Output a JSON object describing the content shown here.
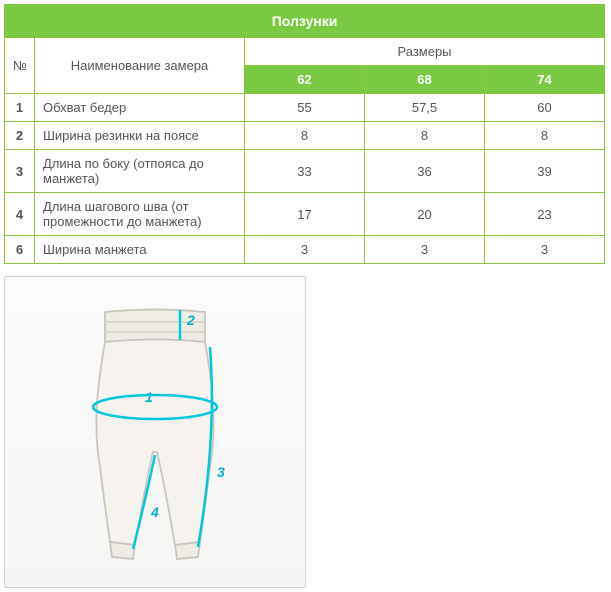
{
  "table": {
    "title": "Ползунки",
    "num_header": "№",
    "name_header": "Наименование замера",
    "sizes_header": "Размеры",
    "sizes": [
      "62",
      "68",
      "74"
    ],
    "rows": [
      {
        "num": "1",
        "name": "Обхват бедер",
        "vals": [
          "55",
          "57,5",
          "60"
        ]
      },
      {
        "num": "2",
        "name": "Ширина резинки на поясе",
        "vals": [
          "8",
          "8",
          "8"
        ]
      },
      {
        "num": "3",
        "name": "Длина по боку (отпояса до манжета)",
        "vals": [
          "33",
          "36",
          "39"
        ]
      },
      {
        "num": "4",
        "name": "Длина шагового шва (от промежности до манжета)",
        "vals": [
          "17",
          "20",
          "23"
        ]
      },
      {
        "num": "6",
        "name": "Ширина манжета",
        "vals": [
          "3",
          "3",
          "3"
        ]
      }
    ]
  },
  "diagram": {
    "labels": {
      "l1": "1",
      "l2": "2",
      "l3": "3",
      "l4": "4"
    }
  },
  "chart_data": {
    "type": "table",
    "title": "Ползунки",
    "columns": [
      "№",
      "Наименование замера",
      "62",
      "68",
      "74"
    ],
    "rows": [
      [
        "1",
        "Обхват бедер",
        55,
        57.5,
        60
      ],
      [
        "2",
        "Ширина резинки на поясе",
        8,
        8,
        8
      ],
      [
        "3",
        "Длина по боку (отпояса до манжета)",
        33,
        36,
        39
      ],
      [
        "4",
        "Длина шагового шва (от промежности до манжета)",
        17,
        20,
        23
      ],
      [
        "6",
        "Ширина манжета",
        3,
        3,
        3
      ]
    ]
  }
}
